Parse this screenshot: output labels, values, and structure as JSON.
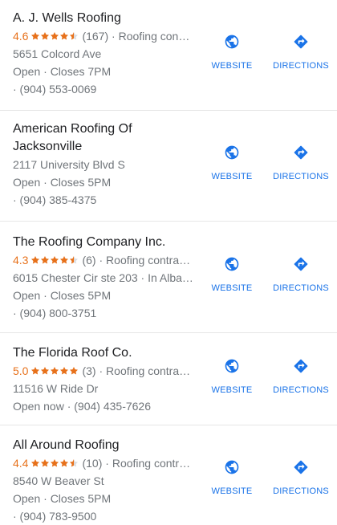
{
  "colors": {
    "accent": "#1a73e8",
    "star": "#e7711b",
    "muted": "#70757a"
  },
  "actions": {
    "website_label": "WEBSITE",
    "directions_label": "DIRECTIONS"
  },
  "listings": [
    {
      "name": "A. J. Wells Roofing",
      "rating": "4.6",
      "stars": 4.6,
      "reviews": "(167)",
      "category": "Roofing con…",
      "address": "5651 Colcord Ave",
      "hours": "Open · Closes 7PM",
      "phone": "· (904) 553-0069"
    },
    {
      "name": "American Roofing Of Jacksonville",
      "address": "2117 University Blvd S",
      "hours": "Open · Closes 5PM",
      "phone": "· (904) 385-4375"
    },
    {
      "name": "The Roofing Company Inc.",
      "rating": "4.3",
      "stars": 4.3,
      "reviews": "(6)",
      "category": "Roofing contra…",
      "address": "6015 Chester Cir ste 203 · In Alban…",
      "hours": "Open · Closes 5PM",
      "phone": "· (904) 800-3751"
    },
    {
      "name": "The Florida Roof Co.",
      "rating": "5.0",
      "stars": 5.0,
      "reviews": "(3)",
      "category": "Roofing contra…",
      "address": "11516 W Ride Dr",
      "hours_phone": "Open now · (904) 435-7626"
    },
    {
      "name": "All Around Roofing",
      "rating": "4.4",
      "stars": 4.4,
      "reviews": "(10)",
      "category": "Roofing contr…",
      "address": "8540 W Beaver St",
      "hours": "Open · Closes 5PM",
      "phone": "· (904) 783-9500"
    }
  ]
}
